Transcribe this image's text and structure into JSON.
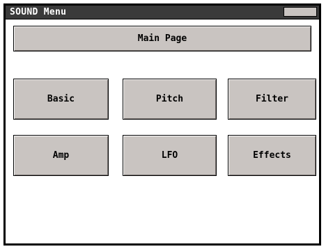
{
  "window": {
    "title": "SOUND Menu"
  },
  "buttons": {
    "main_page": "Main Page",
    "basic": "Basic",
    "pitch": "Pitch",
    "filter": "Filter",
    "amp": "Amp",
    "lfo": "LFO",
    "effects": "Effects"
  },
  "colors": {
    "title_bar": "#3a3a3a",
    "button_face": "#c9c4c1",
    "border": "#000000",
    "background": "#ffffff"
  }
}
